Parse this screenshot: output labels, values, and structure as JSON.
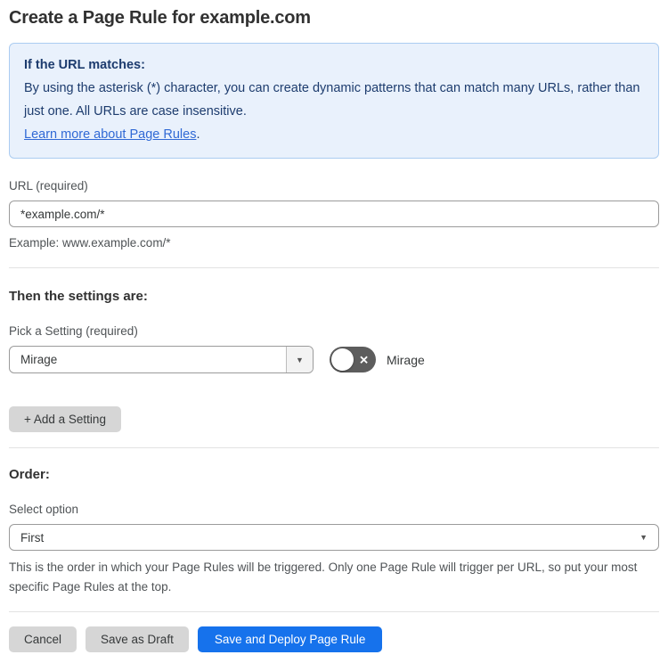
{
  "page": {
    "title": "Create a Page Rule for example.com"
  },
  "info_box": {
    "heading": "If the URL matches:",
    "body": "By using the asterisk (*) character, you can create dynamic patterns that can match many URLs, rather than just one. All URLs are case insensitive.",
    "link_label": "Learn more about Page Rules",
    "link_suffix": "."
  },
  "url_field": {
    "label": "URL (required)",
    "value": "*example.com/*",
    "helper": "Example: www.example.com/*"
  },
  "settings_section": {
    "heading": "Then the settings are:",
    "picker_label": "Pick a Setting (required)",
    "selected_setting": "Mirage",
    "toggle_label": "Mirage",
    "toggle_state": "off",
    "add_setting_label": "+ Add a Setting"
  },
  "order_section": {
    "heading": "Order:",
    "select_label": "Select option",
    "selected_option": "First",
    "helper": "This is the order in which your Page Rules will be triggered. Only one Page Rule will trigger per URL, so put your most specific Page Rules at the top."
  },
  "footer": {
    "cancel_label": "Cancel",
    "save_draft_label": "Save as Draft",
    "save_deploy_label": "Save and Deploy Page Rule"
  },
  "icons": {
    "dropdown_arrow": "▼",
    "toggle_x": "✕"
  },
  "colors": {
    "accent_blue": "#1672ec",
    "info_box_bg": "#e9f1fc",
    "info_box_border": "#abccf1",
    "info_text": "#1d3c6e",
    "link_blue": "#3069d5",
    "toggle_off_bg": "#5d5d5d",
    "button_gray": "#d6d6d6",
    "divider_gray": "#e2e2e2"
  }
}
